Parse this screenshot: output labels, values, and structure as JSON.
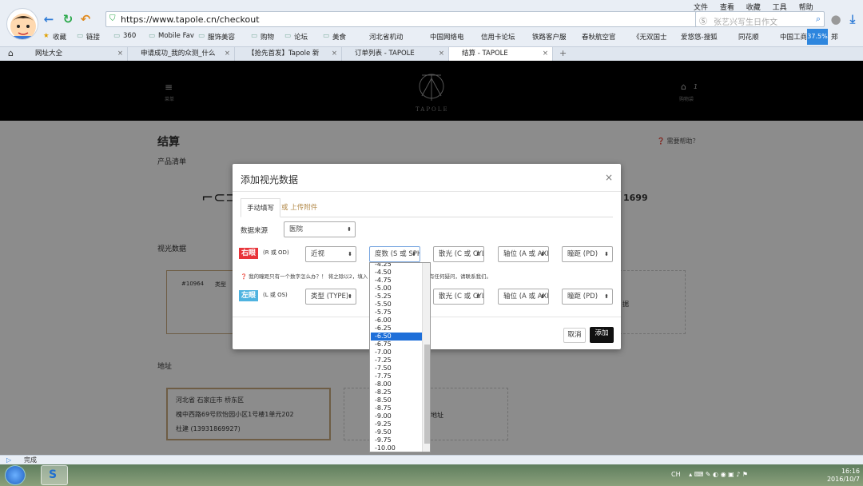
{
  "browser": {
    "url": "https://www.tapole.cn/checkout",
    "search_placeholder": "张艺兴写生日作文",
    "top_menu": [
      "文件",
      "查看",
      "收藏",
      "工具",
      "帮助"
    ],
    "zoom": "37.5%",
    "bookmarks": [
      "收藏",
      "链接",
      "360",
      "Mobile Fav",
      "服饰美容",
      "购物",
      "论坛",
      "美食",
      "河北省机动",
      "中国网络电",
      "信用卡论坛",
      "铁路客户服",
      "春秋航空官",
      "《无双国士",
      "爱悠悠-搜狐",
      "同花顺",
      "中国工商",
      "郑"
    ],
    "tabs": [
      "网址大全",
      "申请成功_我的众测_什么",
      "【抢先首发】Tapole 新",
      "订单列表 - TAPOLE",
      "结算 - TAPOLE"
    ],
    "status": "完成"
  },
  "site": {
    "menu_label": "菜单",
    "logo_text": "TAPOLE",
    "cart_label": "购物袋",
    "cart_count": "1",
    "page_title": "结算",
    "help_link": "需要帮助？",
    "section_products": "产品清单",
    "price": "1699",
    "section_vision": "视光数据",
    "vision_card_id": "#10964",
    "vision_card_type": "类型",
    "add_vision_hint": "据",
    "section_address": "地址",
    "address_line1": "河北省 石家庄市 桥东区",
    "address_line2": "槐中西路69号欣怡园小区1号楼1单元202",
    "address_line3": "杜建 (13931869927)",
    "add_address_hint": "地址"
  },
  "modal": {
    "title": "添加视光数据",
    "tab_manual": "手动填写",
    "tab_upload": "或 上传附件",
    "source_label": "数据来源",
    "source_value": "医院",
    "right_eye_badge": "右眼",
    "right_eye_note": "(R 或 OD)",
    "left_eye_badge": "左眼",
    "left_eye_note": "(L 或 OS)",
    "right_type": "近视",
    "left_type": "类型 (TYPE)",
    "sph": "度数 (S 或 SPH)",
    "cyl": "散光 (C 或 CYL)",
    "axis": "轴位 (A 或 AXIS)",
    "pd": "瞳距 (PD)",
    "hint": "我的瞳距只有一个数字怎么办？！ 将之除以2，填入",
    "hint2": "有任何疑问，请联系我们。",
    "cancel": "取消",
    "add": "添加"
  },
  "dropdown": {
    "options": [
      "-4.25",
      "-4.50",
      "-4.75",
      "-5.00",
      "-5.25",
      "-5.50",
      "-5.75",
      "-6.00",
      "-6.25",
      "-6.50",
      "-6.75",
      "-7.00",
      "-7.25",
      "-7.50",
      "-7.75",
      "-8.00",
      "-8.25",
      "-8.50",
      "-8.75",
      "-9.00",
      "-9.25",
      "-9.50",
      "-9.75",
      "-10.00"
    ],
    "selected": "-6.50"
  },
  "taskbar": {
    "tray_text": "CH",
    "time": "16:16",
    "date": "2016/10/7"
  },
  "colors": {
    "right_eye": "#e8343a",
    "left_eye": "#4fb3e0",
    "accent_gold": "#c8a97e",
    "highlight": "#1e6fd9"
  }
}
